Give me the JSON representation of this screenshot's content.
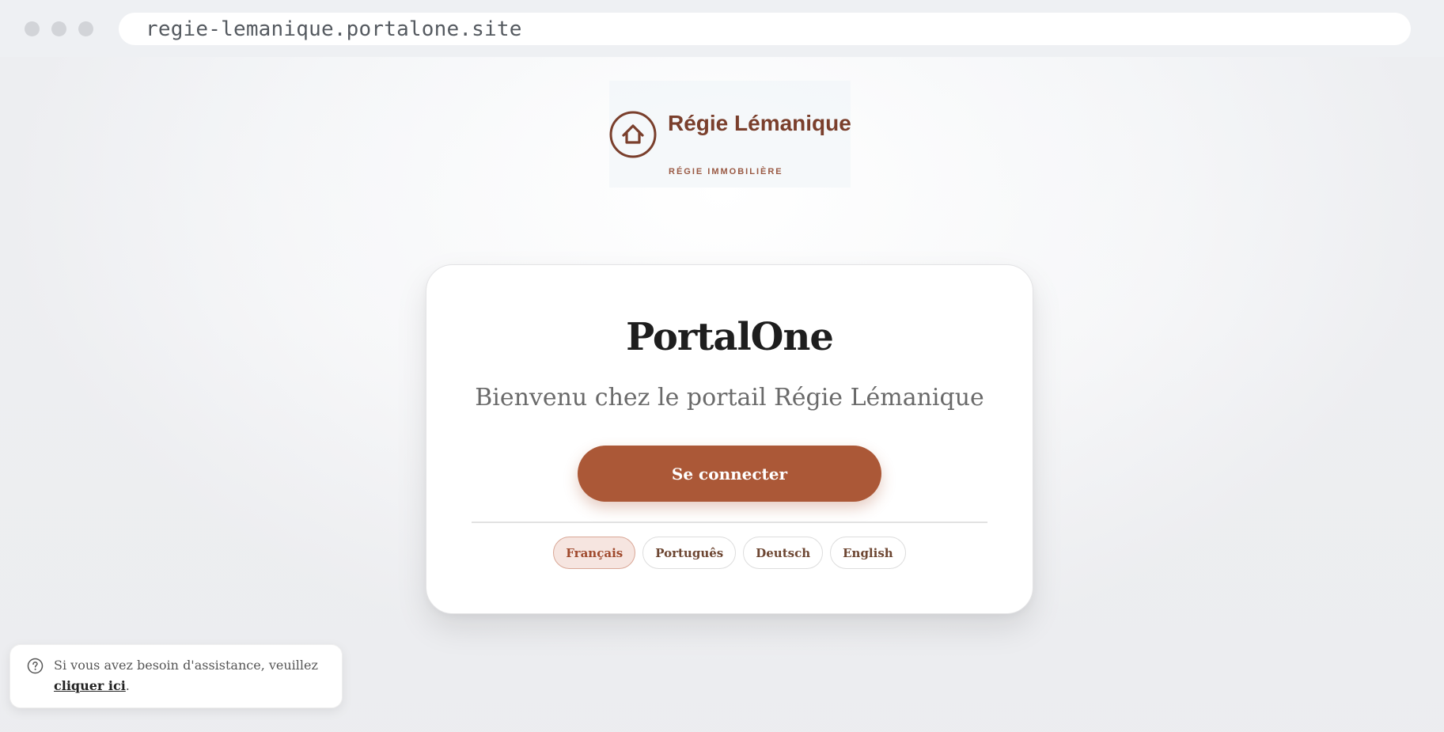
{
  "browser": {
    "url": "regie-lemanique.portalone.site"
  },
  "logo": {
    "name": "Régie Lémanique",
    "tagline": "RÉGIE IMMOBILIÈRE",
    "icon": "house-icon",
    "color": "#7a3f2c"
  },
  "card": {
    "title": "PortalOne",
    "subtitle": "Bienvenu chez le portail Régie Lémanique",
    "login_label": "Se connecter",
    "accent": "#ab5837"
  },
  "languages": [
    {
      "label": "Français",
      "active": true
    },
    {
      "label": "Português",
      "active": false
    },
    {
      "label": "Deutsch",
      "active": false
    },
    {
      "label": "English",
      "active": false
    }
  ],
  "help": {
    "icon": "question-circle-icon",
    "text_before": "Si vous avez besoin d'assistance, veuillez ",
    "link_label": "cliquer ici",
    "text_after": "."
  }
}
